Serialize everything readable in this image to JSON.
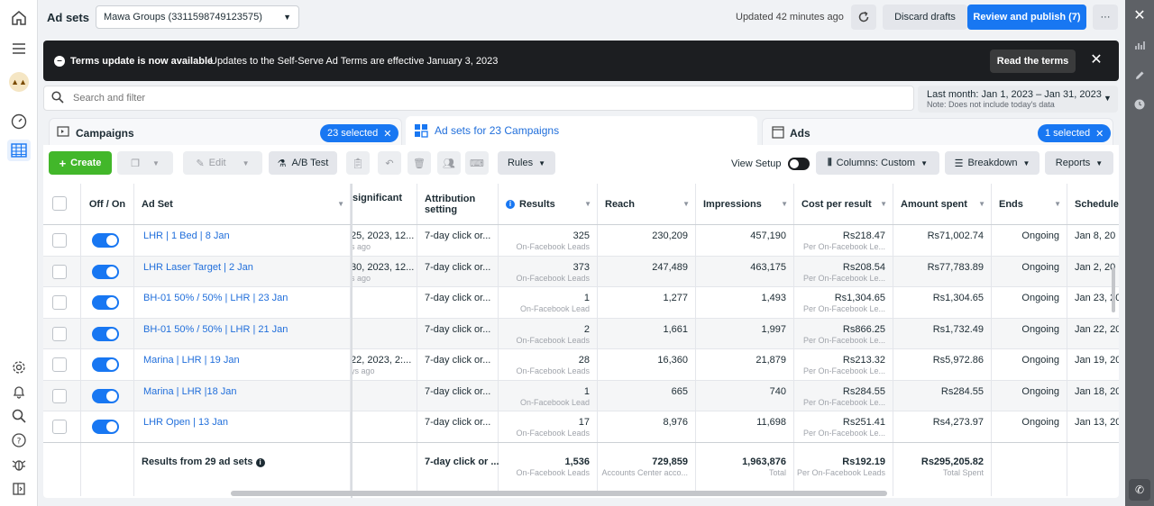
{
  "left_rail": {
    "icons": [
      "home-icon",
      "menu-icon",
      "account-avatar",
      "gauge-icon",
      "table-icon",
      "settings-icon",
      "bell-icon",
      "search-icon",
      "help-icon",
      "bug-icon",
      "panel-icon"
    ]
  },
  "right_rail": {
    "icons": [
      "close-icon",
      "bar-chart-icon",
      "pencil-icon",
      "clock-icon",
      "phone-icon"
    ]
  },
  "topbar": {
    "title": "Ad sets",
    "account": "Mawa Groups (3311598749123575)",
    "updated": "Updated 42 minutes ago",
    "discard": "Discard drafts",
    "publish": "Review and publish (7)",
    "more": "···"
  },
  "banner": {
    "title": "Terms update is now available",
    "text": "Updates to the Self-Serve Ad Terms are effective January 3, 2023",
    "read_terms": "Read the terms"
  },
  "search": {
    "placeholder": "Search and filter"
  },
  "date_range": {
    "label": "Last month: Jan 1, 2023 – Jan 31, 2023",
    "note": "Note: Does not include today's data"
  },
  "tabs": {
    "campaigns": {
      "label": "Campaigns",
      "pill": "23 selected"
    },
    "adsets": {
      "label": "Ad sets for 23 Campaigns"
    },
    "ads": {
      "label": "Ads",
      "pill": "1 selected"
    }
  },
  "toolbar": {
    "create": "Create",
    "edit": "Edit",
    "ab_test": "A/B Test",
    "rules": "Rules",
    "view_setup": "View Setup",
    "columns": "Columns: Custom",
    "breakdown": "Breakdown",
    "reports": "Reports"
  },
  "columns": {
    "off_on": "Off / On",
    "ad_set": "Ad Set",
    "significant": "significant",
    "attribution": "Attribution setting",
    "results": "Results",
    "reach": "Reach",
    "impressions": "Impressions",
    "cost": "Cost per result",
    "amount": "Amount spent",
    "ends": "Ends",
    "schedule": "Schedule"
  },
  "rows": [
    {
      "name": "LHR | 1 Bed | 8 Jan",
      "sig": "25, 2023, 12...",
      "sig_sub": "s ago",
      "attr": "7-day click or...",
      "results": "325",
      "results_sub": "On-Facebook Leads",
      "reach": "230,209",
      "impressions": "457,190",
      "cost": "Rs218.47",
      "cost_sub": "Per On-Facebook Le...",
      "amount": "Rs71,002.74",
      "ends": "Ongoing",
      "schedule": "Jan 8, 20"
    },
    {
      "name": "LHR Laser Target | 2 Jan",
      "sig": "30, 2023, 12...",
      "sig_sub": "s ago",
      "attr": "7-day click or...",
      "results": "373",
      "results_sub": "On-Facebook Leads",
      "reach": "247,489",
      "impressions": "463,175",
      "cost": "Rs208.54",
      "cost_sub": "Per On-Facebook Le...",
      "amount": "Rs77,783.89",
      "ends": "Ongoing",
      "schedule": "Jan 2, 20"
    },
    {
      "name": "BH-01 50% / 50% | LHR | 23 Jan",
      "sig": "",
      "sig_sub": "",
      "attr": "7-day click or...",
      "results": "1",
      "results_sub": "On-Facebook Lead",
      "reach": "1,277",
      "impressions": "1,493",
      "cost": "Rs1,304.65",
      "cost_sub": "Per On-Facebook Le...",
      "amount": "Rs1,304.65",
      "ends": "Ongoing",
      "schedule": "Jan 23, 20"
    },
    {
      "name": "BH-01 50% / 50% | LHR | 21 Jan",
      "sig": "",
      "sig_sub": "",
      "attr": "7-day click or...",
      "results": "2",
      "results_sub": "On-Facebook Leads",
      "reach": "1,661",
      "impressions": "1,997",
      "cost": "Rs866.25",
      "cost_sub": "Per On-Facebook Le...",
      "amount": "Rs1,732.49",
      "ends": "Ongoing",
      "schedule": "Jan 22, 20"
    },
    {
      "name": "Marina | LHR | 19 Jan",
      "sig": "22, 2023, 2:...",
      "sig_sub": "ys ago",
      "attr": "7-day click or...",
      "results": "28",
      "results_sub": "On-Facebook Leads",
      "reach": "16,360",
      "impressions": "21,879",
      "cost": "Rs213.32",
      "cost_sub": "Per On-Facebook Le...",
      "amount": "Rs5,972.86",
      "ends": "Ongoing",
      "schedule": "Jan 19, 20"
    },
    {
      "name": "Marina | LHR |18 Jan",
      "sig": "",
      "sig_sub": "",
      "attr": "7-day click or...",
      "results": "1",
      "results_sub": "On-Facebook Lead",
      "reach": "665",
      "impressions": "740",
      "cost": "Rs284.55",
      "cost_sub": "Per On-Facebook Le...",
      "amount": "Rs284.55",
      "ends": "Ongoing",
      "schedule": "Jan 18, 20"
    },
    {
      "name": "LHR Open | 13 Jan",
      "sig": "",
      "sig_sub": "",
      "attr": "7-day click or...",
      "results": "17",
      "results_sub": "On-Facebook Leads",
      "reach": "8,976",
      "impressions": "11,698",
      "cost": "Rs251.41",
      "cost_sub": "Per On-Facebook Le...",
      "amount": "Rs4,273.97",
      "ends": "Ongoing",
      "schedule": "Jan 13, 20"
    }
  ],
  "totals": {
    "label": "Results from 29 ad sets",
    "attr": "7-day click or ...",
    "results": "1,536",
    "results_sub": "On-Facebook Leads",
    "reach": "729,859",
    "reach_sub": "Accounts Center acco...",
    "impressions": "1,963,876",
    "impressions_sub": "Total",
    "cost": "Rs192.19",
    "cost_sub": "Per On-Facebook Leads",
    "amount": "Rs295,205.82",
    "amount_sub": "Total Spent"
  },
  "colors": {
    "primary": "#1877f2",
    "create": "#42b72a",
    "banner": "#1c1e21",
    "link": "#216fdb"
  }
}
